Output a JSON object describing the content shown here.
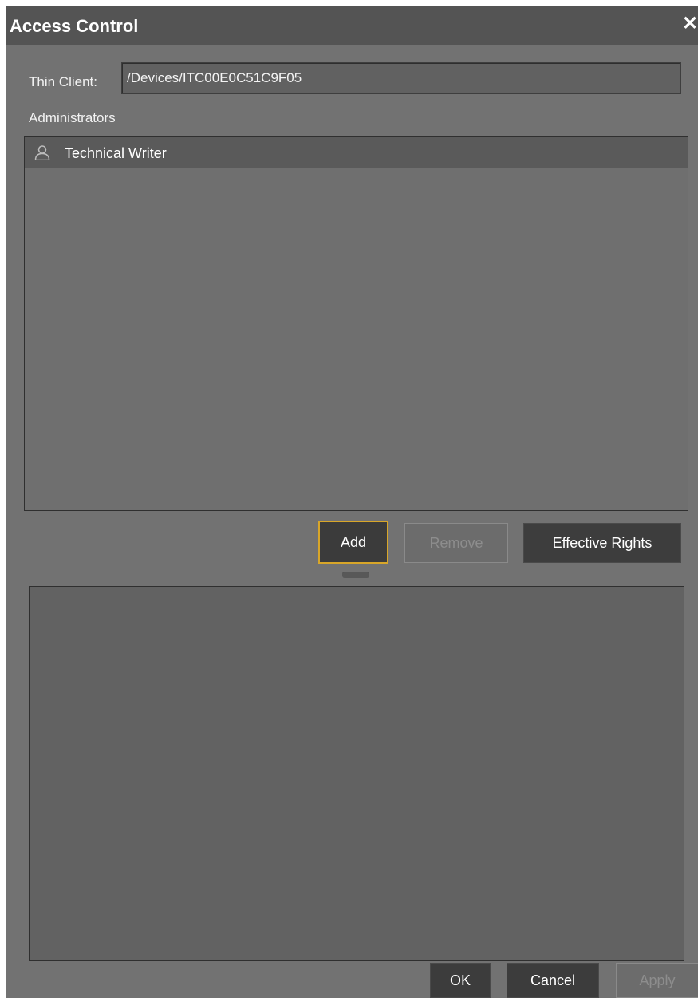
{
  "dialog": {
    "title": "Access Control",
    "close_icon": "close-icon"
  },
  "thin_client": {
    "label": "Thin Client:",
    "value": "/Devices/ITC00E0C51C9F05"
  },
  "administrators": {
    "label": "Administrators",
    "items": [
      {
        "name": "Technical Writer",
        "icon": "user-icon",
        "selected": true
      }
    ]
  },
  "buttons": {
    "add": "Add",
    "remove": "Remove",
    "effective_rights": "Effective Rights",
    "ok": "OK",
    "cancel": "Cancel",
    "apply": "Apply"
  },
  "colors": {
    "dialog_background": "#727272",
    "titlebar": "#545454",
    "focus_border": "#d8a629",
    "button_dark": "#3c3c3c",
    "disabled_text": "#8d8d8d"
  }
}
